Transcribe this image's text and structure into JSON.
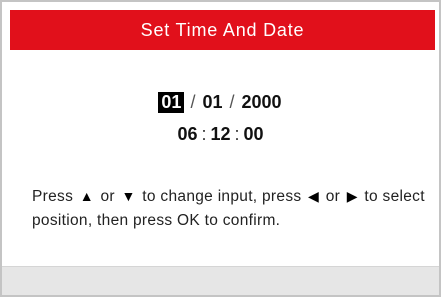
{
  "header": {
    "title": "Set Time And Date"
  },
  "date": {
    "month": "01",
    "day": "01",
    "year": "2000",
    "separator": "/"
  },
  "time": {
    "hour": "06",
    "minute": "12",
    "second": "00",
    "separator": ":"
  },
  "instruction": {
    "part1": "Press",
    "up_arrow": "▲",
    "or1": "or",
    "down_arrow": "▼",
    "part2": "to change input, press",
    "left_arrow": "◀",
    "or2": "or",
    "right_arrow": "▶",
    "part3": "to select position, then press OK to confirm."
  },
  "colors": {
    "title_bar": "#e1101b",
    "selected_field": "#000000",
    "bottom_bar": "#e6e6e6"
  }
}
